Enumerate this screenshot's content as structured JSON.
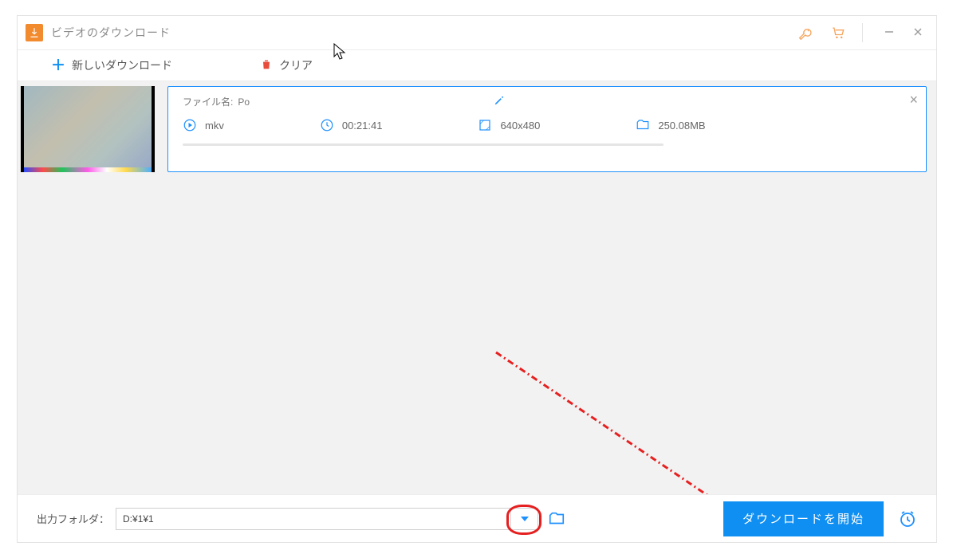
{
  "titlebar": {
    "title": "ビデオのダウンロード"
  },
  "toolbar": {
    "new_download_label": "新しいダウンロード",
    "clear_label": "クリア"
  },
  "item": {
    "filename_label": "ファイル名:",
    "filename_value": "Po",
    "format": "mkv",
    "duration": "00:21:41",
    "resolution": "640x480",
    "filesize": "250.08MB"
  },
  "footer": {
    "output_folder_label": "出力フォルダ：",
    "output_folder_value": "D:¥1¥1",
    "start_button_label": "ダウンロードを開始"
  }
}
